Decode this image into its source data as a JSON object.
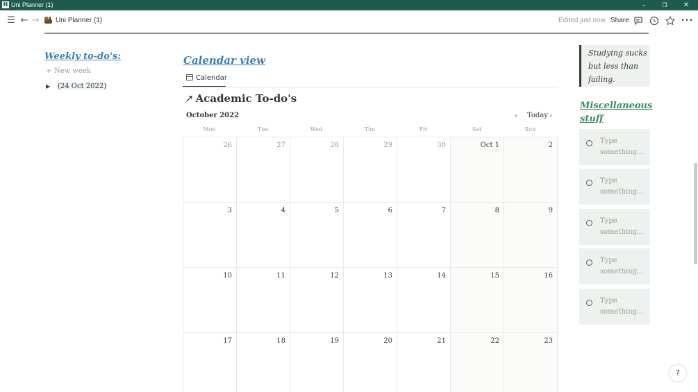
{
  "window": {
    "title": "Uni Planner (1)",
    "app_icon": "N",
    "controls": {
      "minimize": "–",
      "restore": "❐",
      "close": "✕"
    }
  },
  "topbar": {
    "menu_icon": "☰",
    "back_icon": "←",
    "forward_icon": "→",
    "breadcrumb": "Uni Planner (1)",
    "edited": "Edited just now",
    "share": "Share",
    "more_icon": "•••"
  },
  "left": {
    "title": "Weekly to-do's:",
    "new_week": "New week",
    "plus_icon": "+",
    "toggle_icon": "▶",
    "week_item": "(24 Oct 2022)"
  },
  "calendar": {
    "section_title": "Calendar view",
    "view_tab": "Calendar",
    "arrow_icon": "↗",
    "db_title": "Academic To-do's",
    "month": "October 2022",
    "prev": "‹",
    "today": "Today",
    "next": "›",
    "weekdays": [
      "Mon",
      "Tue",
      "Wed",
      "Thu",
      "Fri",
      "Sat",
      "Sun"
    ],
    "weeks": [
      [
        "26",
        "27",
        "28",
        "29",
        "30",
        "Oct 1",
        "2"
      ],
      [
        "3",
        "4",
        "5",
        "6",
        "7",
        "8",
        "9"
      ],
      [
        "10",
        "11",
        "12",
        "13",
        "14",
        "15",
        "16"
      ],
      [
        "17",
        "18",
        "19",
        "20",
        "21",
        "22",
        "23"
      ]
    ]
  },
  "right": {
    "quote_lines": [
      "Studying sucks",
      "but less than",
      "failing."
    ],
    "misc_title": "Miscellaneous stuff",
    "todos": [
      {
        "line1": "Type",
        "line2": "something..."
      },
      {
        "line1": "Type",
        "line2": "something..."
      },
      {
        "line1": "Type",
        "line2": "something..."
      },
      {
        "line1": "Type",
        "line2": "something..."
      },
      {
        "line1": "Type",
        "line2": "something..."
      }
    ]
  },
  "help": "?"
}
